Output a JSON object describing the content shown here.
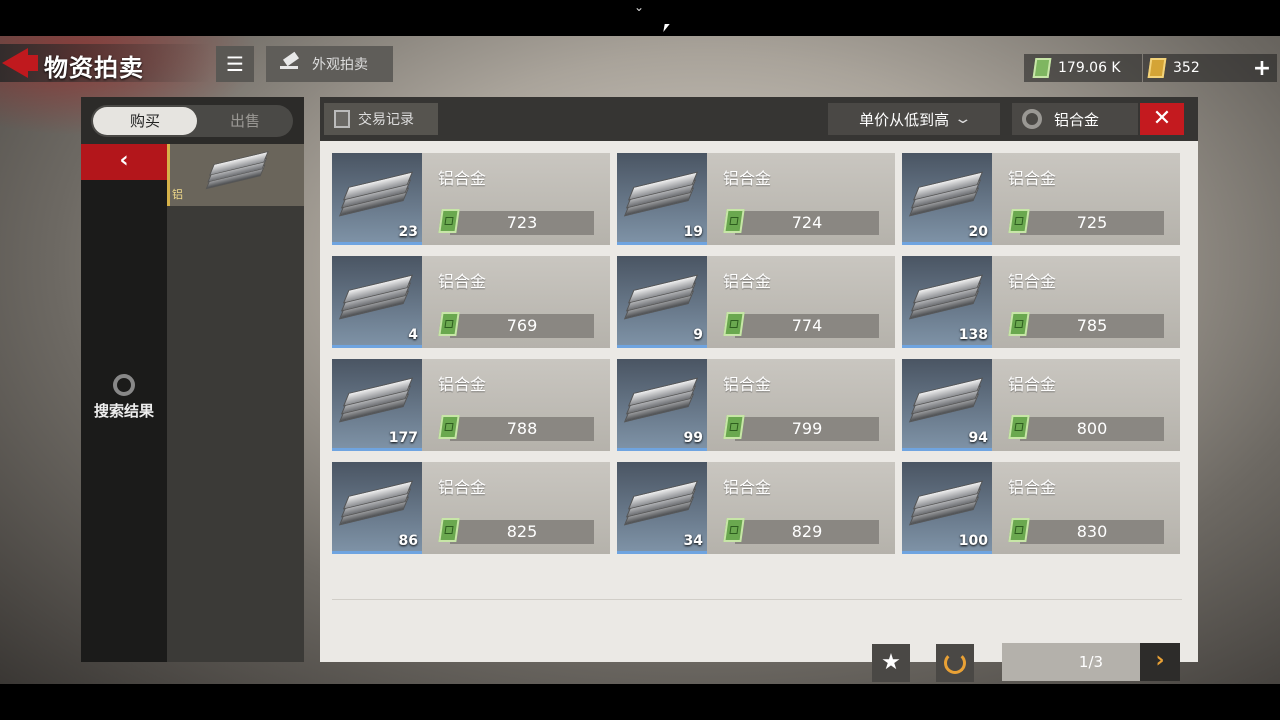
{
  "header": {
    "title": "物资拍卖",
    "appearance_auction": "外观拍卖",
    "cash": "179.06 K",
    "tickets": "352",
    "plus": "+"
  },
  "tabs": {
    "buy": "购买",
    "sell": "出售"
  },
  "sidebar": {
    "back_glyph": "‹",
    "search_result": "搜索结果",
    "selected_item_label": "铝"
  },
  "toolbar": {
    "transaction_log": "交易记录",
    "sort": "单价从低到高",
    "search_value": "铝合金",
    "clear": "✕"
  },
  "listings": [
    {
      "name": "铝合金",
      "qty": "23",
      "price": "723"
    },
    {
      "name": "铝合金",
      "qty": "19",
      "price": "724"
    },
    {
      "name": "铝合金",
      "qty": "20",
      "price": "725"
    },
    {
      "name": "铝合金",
      "qty": "4",
      "price": "769"
    },
    {
      "name": "铝合金",
      "qty": "9",
      "price": "774"
    },
    {
      "name": "铝合金",
      "qty": "138",
      "price": "785"
    },
    {
      "name": "铝合金",
      "qty": "177",
      "price": "788"
    },
    {
      "name": "铝合金",
      "qty": "99",
      "price": "799"
    },
    {
      "name": "铝合金",
      "qty": "94",
      "price": "800"
    },
    {
      "name": "铝合金",
      "qty": "86",
      "price": "825"
    },
    {
      "name": "铝合金",
      "qty": "34",
      "price": "829"
    },
    {
      "name": "铝合金",
      "qty": "100",
      "price": "830"
    }
  ],
  "pagination": {
    "page": "1/3",
    "next": "›"
  },
  "icons": [
    "chevron-down-icon",
    "back-arrow-icon",
    "menu-icon",
    "gavel-icon",
    "cash-icon",
    "ticket-icon",
    "search-icon",
    "document-icon",
    "star-icon",
    "refresh-icon",
    "aluminum-ingot-icon"
  ],
  "colors": {
    "accent_red": "#c0191e",
    "quantity_underline": "#6fa4e0",
    "cash_green": "#6aa84f",
    "refresh_orange": "#e9a135"
  }
}
